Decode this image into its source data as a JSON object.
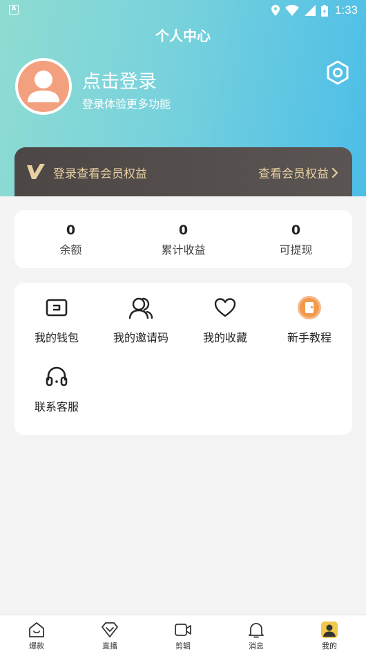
{
  "status_bar": {
    "time": "1:33",
    "notification_badge": "A"
  },
  "header": {
    "title": "个人中心",
    "login_title": "点击登录",
    "login_subtitle": "登录体验更多功能"
  },
  "vip": {
    "left_label": "登录查看会员权益",
    "right_label": "查看会员权益"
  },
  "stats": [
    {
      "value": "0",
      "label": "余额"
    },
    {
      "value": "0",
      "label": "累计收益"
    },
    {
      "value": "0",
      "label": "可提现"
    }
  ],
  "menu": [
    {
      "label": "我的钱包",
      "icon": "wallet-icon"
    },
    {
      "label": "我的邀请码",
      "icon": "invite-icon"
    },
    {
      "label": "我的收藏",
      "icon": "heart-icon"
    },
    {
      "label": "新手教程",
      "icon": "tutorial-icon"
    },
    {
      "label": "联系客服",
      "icon": "headset-icon"
    }
  ],
  "tabs": [
    {
      "label": "爆款",
      "icon": "home-icon"
    },
    {
      "label": "直播",
      "icon": "live-icon"
    },
    {
      "label": "剪辑",
      "icon": "video-icon"
    },
    {
      "label": "消息",
      "icon": "bell-icon"
    },
    {
      "label": "我的",
      "icon": "profile-icon",
      "active": true
    }
  ],
  "colors": {
    "accent_gold": "#e8cfa2",
    "vip_bar": "#4c4745",
    "avatar_bg": "#f3a07e",
    "tutorial_orange": "#f29a4b"
  }
}
